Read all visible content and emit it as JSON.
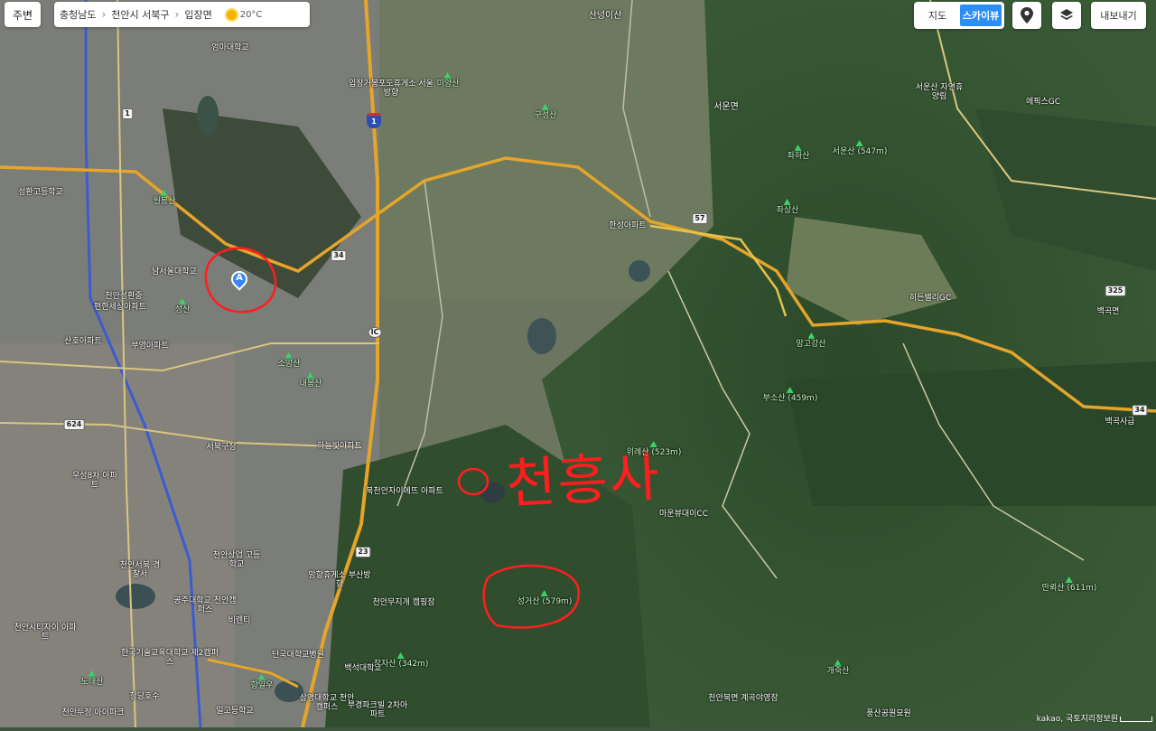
{
  "toolbar": {
    "nearby_label": "주변",
    "breadcrumb": [
      "충청남도",
      "천안시 서북구",
      "입장면"
    ],
    "temperature": "20°C",
    "map_type_options": [
      "지도",
      "스카이뷰"
    ],
    "map_type_selected": "스카이뷰",
    "roadview_icon": "roadview-pin-icon",
    "layers_icon": "layers-icon",
    "export_label": "내보내기"
  },
  "marker": {
    "letter": "A"
  },
  "annotation": {
    "text": "천흥사",
    "color": "#ff1e1e"
  },
  "attribution": "kakao, 국토지리정보원",
  "places": [
    "산넝이산",
    "엄마대학교",
    "입장거봉포도휴게소 서울방향",
    "미양산",
    "구성산",
    "서운면",
    "좌하산",
    "좌상산",
    "서운산 자연휴양림",
    "에픽스GC",
    "한성아파트",
    "성환고등학교",
    "월봉산",
    "남서울대학교",
    "천안성환중",
    "편한세상아파트",
    "성산",
    "산호아파트",
    "부영아파트",
    "소망산",
    "내봉산",
    "히든밸리GC",
    "망고강산",
    "백곡면",
    "백곡사급",
    "위례산",
    "마운뷰대이CC",
    "서북구청",
    "하늘빛아파트",
    "북천안자이에뜨 아파트",
    "우성8차 아파트",
    "천안서북 경찰서",
    "천안상업 고등학교",
    "망향휴게소 부산방향",
    "천안무지개 캠핑장",
    "비렌티",
    "공주대학교 천안캠퍼스",
    "한국기술교육대학교 제2캠퍼스",
    "단국대학교병원",
    "백석대학교",
    "상명대학교 천안캠퍼스",
    "부경파크빌 2차아파트",
    "천안두정 아이파크",
    "개죽산",
    "천안북면 계곡야영장",
    "풍산공원묘원",
    "천안시티자이 아파트",
    "일고등학교",
    "노태산",
    "향일우",
    "청당호수",
    "서운산 (547m)",
    "부소산 (459m)",
    "위례산 (523m)",
    "성거산 (579m)",
    "장자산 (342m)",
    "만뢰산 (611m)"
  ],
  "road_shields": [
    "1",
    "1",
    "34",
    "57",
    "325",
    "34",
    "624",
    "23",
    "IC"
  ]
}
